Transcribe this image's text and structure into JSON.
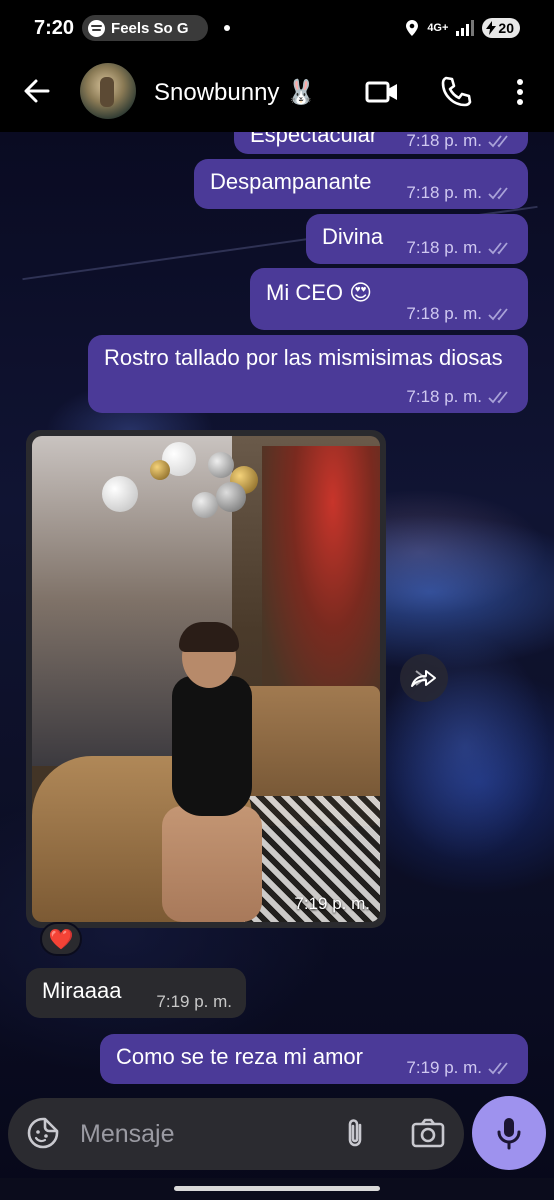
{
  "status_bar": {
    "time": "7:20",
    "now_playing": "Feels So G",
    "network": "4G+",
    "battery": "20"
  },
  "header": {
    "contact_name": "Snowbunny 🐰"
  },
  "messages": [
    {
      "text": "Espectacular",
      "time": "7:18 p. m.",
      "direction": "out"
    },
    {
      "text": "Despampanante",
      "time": "7:18 p. m.",
      "direction": "out"
    },
    {
      "text": "Divina",
      "time": "7:18 p. m.",
      "direction": "out"
    },
    {
      "text": "Mi CEO 😍",
      "time": "7:18 p. m.",
      "direction": "out"
    },
    {
      "text": "Rostro tallado por las mismisimas diosas",
      "time": "7:18 p. m.",
      "direction": "out"
    },
    {
      "type": "photo",
      "time": "7:19 p. m.",
      "direction": "in",
      "reaction": "❤️"
    },
    {
      "text": "Miraaaa",
      "time": "7:19 p. m.",
      "direction": "in"
    },
    {
      "text": "Como se te reza mi amor",
      "time": "7:19 p. m.",
      "direction": "out"
    }
  ],
  "composer": {
    "placeholder": "Mensaje"
  },
  "colors": {
    "outgoing_bubble": "#4b3a98",
    "incoming_bubble": "#2a2a2e",
    "mic_button": "#9e92ee"
  }
}
